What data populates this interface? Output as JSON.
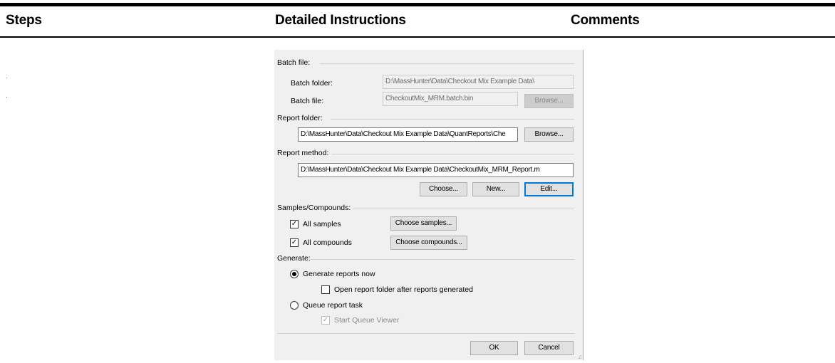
{
  "table": {
    "headers": {
      "steps": "Steps",
      "instructions": "Detailed Instructions",
      "comments": "Comments"
    }
  },
  "dialog": {
    "batch_group": "Batch file:",
    "batch_folder_label": "Batch folder:",
    "batch_folder_value": "D:\\MassHunter\\Data\\Checkout Mix Example Data\\",
    "batch_file_label": "Batch file:",
    "batch_file_value": "CheckoutMix_MRM.batch.bin",
    "batch_browse": "Browse...",
    "report_folder_group": "Report folder:",
    "report_folder_value": "D:\\MassHunter\\Data\\Checkout Mix Example Data\\QuantReports\\Che",
    "report_folder_browse": "Browse...",
    "report_method_group": "Report method:",
    "report_method_value": "D:\\MassHunter\\Data\\Checkout Mix Example Data\\CheckoutMix_MRM_Report.m",
    "choose_button": "Choose...",
    "new_button": "New...",
    "edit_button": "Edit...",
    "samples_group": "Samples/Compounds:",
    "all_samples_label": "All samples",
    "all_samples_checked": true,
    "choose_samples": "Choose samples...",
    "all_compounds_label": "All compounds",
    "all_compounds_checked": true,
    "choose_compounds": "Choose compounds...",
    "generate_group": "Generate:",
    "generate_now_label": "Generate reports now",
    "open_folder_label": "Open report folder after reports generated",
    "open_folder_checked": false,
    "queue_task_label": "Queue report task",
    "start_queue_label": "Start Queue Viewer",
    "start_queue_checked": true,
    "ok_button": "OK",
    "cancel_button": "Cancel",
    "check_glyph": "✓"
  }
}
